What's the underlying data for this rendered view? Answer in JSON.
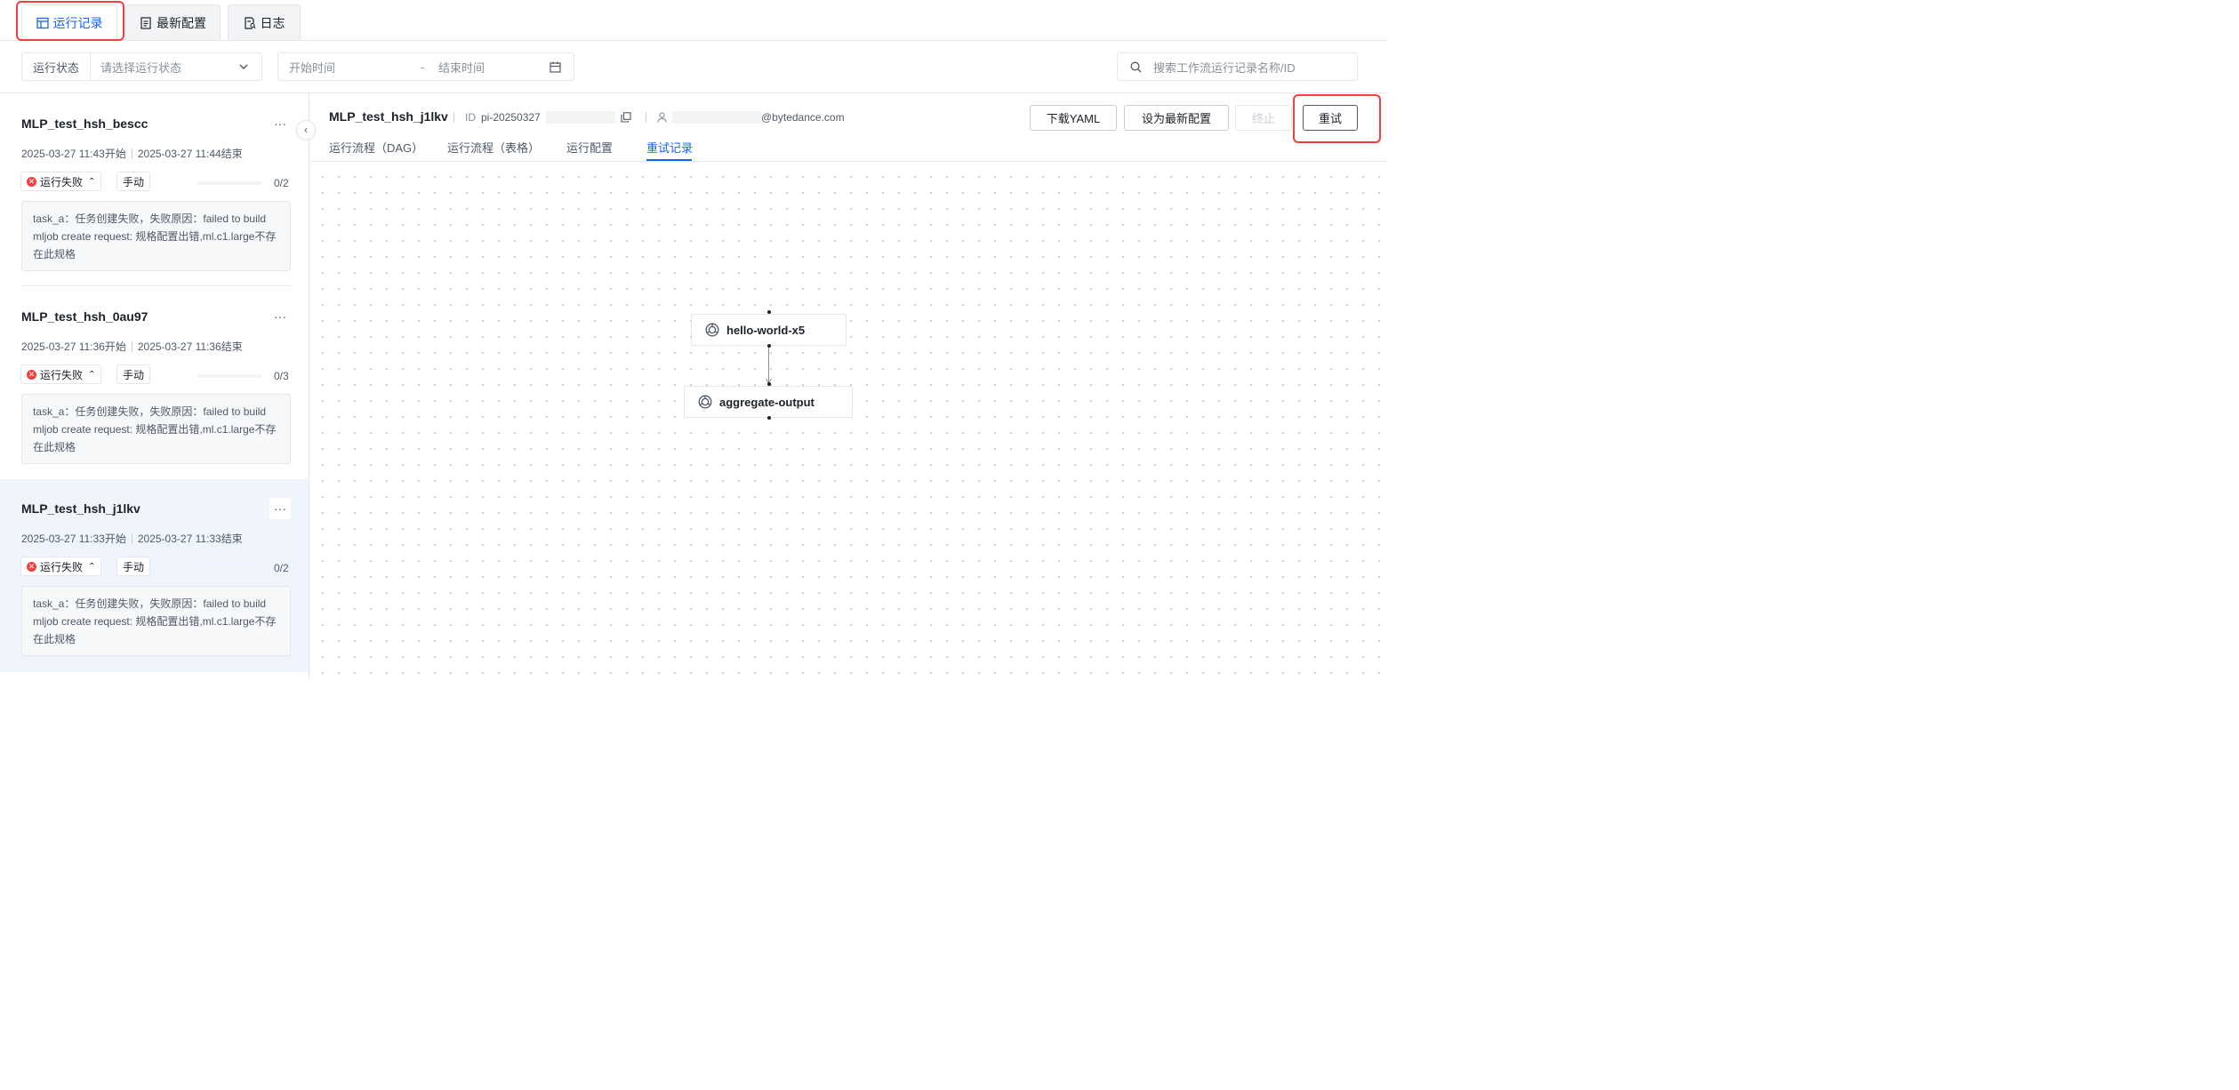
{
  "tabs": [
    {
      "label": "运行记录",
      "icon": "table-icon",
      "active": true
    },
    {
      "label": "最新配置",
      "icon": "document-icon",
      "active": false
    },
    {
      "label": "日志",
      "icon": "log-search-icon",
      "active": false
    }
  ],
  "filters": {
    "status_label": "运行状态",
    "status_placeholder": "请选择运行状态",
    "start_placeholder": "开始时间",
    "range_sep": "-",
    "end_placeholder": "结束时间",
    "search_placeholder": "搜索工作流运行记录名称/ID"
  },
  "runs": [
    {
      "name": "MLP_test_hsh_bescc",
      "start": "2025-03-27 11:43开始",
      "end": "2025-03-27 11:44结束",
      "status": "运行失败",
      "trigger": "手动",
      "progress": "0/2",
      "progress_fraction": 0,
      "error": "task_a：任务创建失败，失败原因：failed to build mljob create request: 规格配置出错,ml.c1.large不存在此规格",
      "selected": false
    },
    {
      "name": "MLP_test_hsh_0au97",
      "start": "2025-03-27 11:36开始",
      "end": "2025-03-27 11:36结束",
      "status": "运行失败",
      "trigger": "手动",
      "progress": "0/3",
      "progress_fraction": 0,
      "error": "task_a：任务创建失败，失败原因：failed to build mljob create request: 规格配置出错,ml.c1.large不存在此规格",
      "selected": false
    },
    {
      "name": "MLP_test_hsh_j1lkv",
      "start": "2025-03-27 11:33开始",
      "end": "2025-03-27 11:33结束",
      "status": "运行失败",
      "trigger": "手动",
      "progress": "0/2",
      "progress_fraction": 0,
      "error": "task_a：任务创建失败，失败原因：failed to build mljob create request: 规格配置出错,ml.c1.large不存在此规格",
      "selected": true
    }
  ],
  "detail": {
    "title": "MLP_test_hsh_j1lkv",
    "id_label": "ID",
    "id_value": "pi-20250327",
    "user_email_suffix": "@bytedance.com",
    "buttons": {
      "download": "下载YAML",
      "set_latest": "设为最新配置",
      "stop": "终止",
      "retry": "重试"
    },
    "subtabs": [
      "运行流程（DAG）",
      "运行流程（表格）",
      "运行配置",
      "重试记录"
    ],
    "active_subtab": "重试记录"
  },
  "dag": {
    "nodes": [
      {
        "label": "hello-world-x5"
      },
      {
        "label": "aggregate-output"
      }
    ]
  },
  "colors": {
    "accent": "#1664ff",
    "error": "#f53f3f",
    "highlight": "#f53f3f"
  }
}
